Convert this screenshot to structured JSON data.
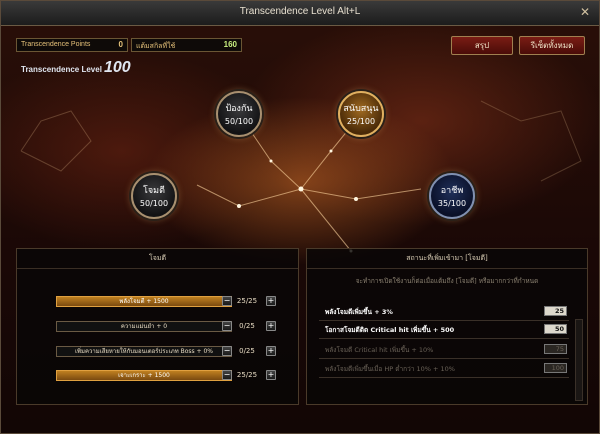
{
  "window": {
    "title": "Transcendence Level Alt+L"
  },
  "stats": {
    "points_label": "Transcendence Points",
    "points_value": "0",
    "bonus_label": "แต้มสกิลที่ใช้",
    "bonus_value": "160"
  },
  "buttons": {
    "summary": "สรุป",
    "reset_all": "รีเซ็ตทั้งหมด"
  },
  "level": {
    "label": "Transcendence Level",
    "value": "100"
  },
  "nodes": [
    {
      "name": "ป้องกัน",
      "value": "50/100"
    },
    {
      "name": "สนับสนุน",
      "value": "25/100"
    },
    {
      "name": "โจมตี",
      "value": "50/100"
    },
    {
      "name": "อาชีพ",
      "value": "35/100"
    }
  ],
  "left_panel": {
    "title": "โจมตี",
    "skills": [
      {
        "label": "พลังโจมตี + 1500",
        "count": "25/25",
        "active": true
      },
      {
        "label": "ความแม่นยำ + 0",
        "count": "0/25",
        "active": false
      },
      {
        "label": "เพิ่มความเสียหายให้กับมอนเตอร์ประเภท Boss + 0%",
        "count": "0/25",
        "active": false
      },
      {
        "label": "เจาะเกราะ + 1500",
        "count": "25/25",
        "active": true
      }
    ]
  },
  "right_panel": {
    "title": "สถานะที่เพิ่มเข้ามา [โจมตี]",
    "note": "จะทำการเปิดใช้งานก็ต่อเมื่อแต้มถึง [โจมตี] หรือมากกว่าที่กำหนด",
    "effects": [
      {
        "label": "พลังโจมตีเพิ่มขึ้น + 3%",
        "value": "25",
        "active": true
      },
      {
        "label": "โอกาสโจมตีติด Critical hit เพิ่มขึ้น + 500",
        "value": "50",
        "active": true
      },
      {
        "label": "พลังโจมตี Critical hit เพิ่มขึ้น + 10%",
        "value": "75",
        "active": false
      },
      {
        "label": "พลังโจมตีเพิ่มขึ้นเมื่อ HP ต่ำกว่า 10% + 10%",
        "value": "100",
        "active": false
      }
    ]
  },
  "icons": {
    "close": "close-icon",
    "minus": "minus-icon",
    "plus": "plus-icon"
  }
}
